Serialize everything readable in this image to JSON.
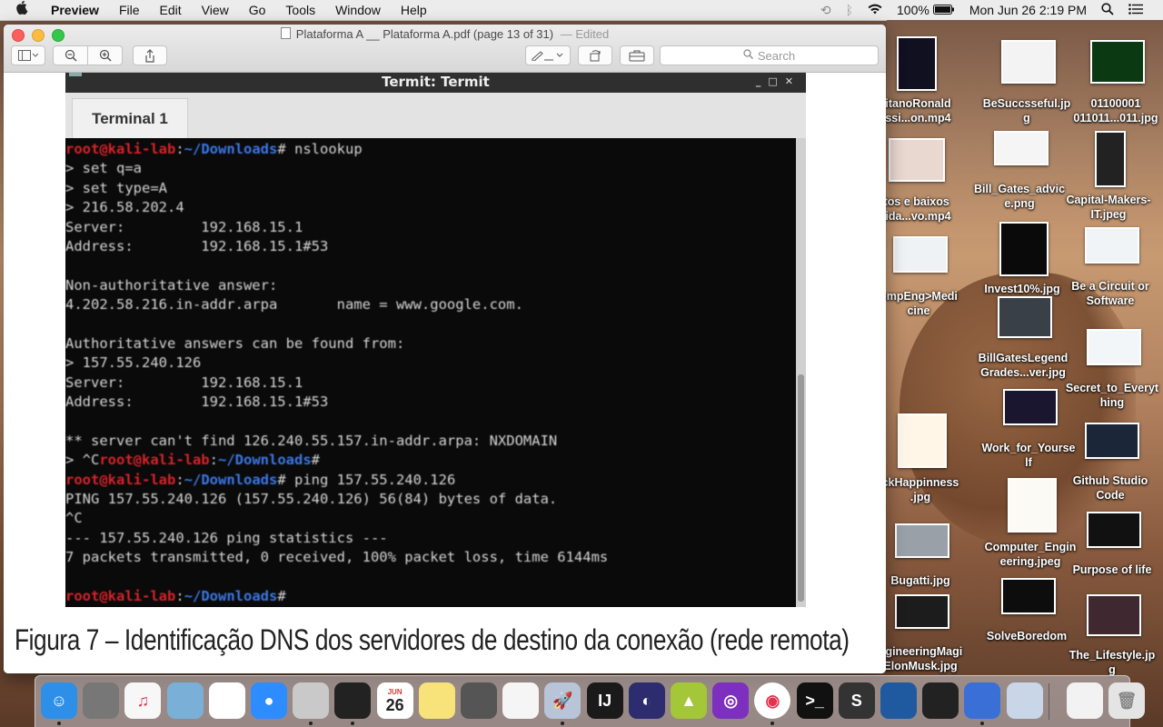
{
  "menubar": {
    "apple": "",
    "app_name": "Preview",
    "items": [
      "File",
      "Edit",
      "View",
      "Go",
      "Tools",
      "Window",
      "Help"
    ],
    "battery": "100%",
    "datetime": "Mon Jun 26  2:19 PM"
  },
  "window": {
    "title": "Plataforma A __ Plataforma A.pdf (page 13 of 31)",
    "edited": "— Edited",
    "search_placeholder": "Search"
  },
  "terminal": {
    "window_title": "Termit: Termit",
    "tab_label": "Terminal 1",
    "lines": [
      {
        "user": "root@kali-lab",
        "path": "~/Downloads",
        "cmd": "# nslookup"
      },
      {
        "text": "> set q=a"
      },
      {
        "text": "> set type=A"
      },
      {
        "text": "> 216.58.202.4"
      },
      {
        "text": "Server:         192.168.15.1"
      },
      {
        "text": "Address:        192.168.15.1#53"
      },
      {
        "text": ""
      },
      {
        "text": "Non-authoritative answer:"
      },
      {
        "text": "4.202.58.216.in-addr.arpa       name = www.google.com."
      },
      {
        "text": ""
      },
      {
        "text": "Authoritative answers can be found from:"
      },
      {
        "text": "> 157.55.240.126"
      },
      {
        "text": "Server:         192.168.15.1"
      },
      {
        "text": "Address:        192.168.15.1#53"
      },
      {
        "text": ""
      },
      {
        "text": "** server can't find 126.240.55.157.in-addr.arpa: NXDOMAIN"
      },
      {
        "prefix": "> ^C",
        "user": "root@kali-lab",
        "path": "~/Downloads",
        "cmd": "#"
      },
      {
        "user": "root@kali-lab",
        "path": "~/Downloads",
        "cmd": "# ping 157.55.240.126"
      },
      {
        "text": "PING 157.55.240.126 (157.55.240.126) 56(84) bytes of data."
      },
      {
        "text": "^C"
      },
      {
        "text": "--- 157.55.240.126 ping statistics ---"
      },
      {
        "text": "7 packets transmitted, 0 received, 100% packet loss, time 6144ms"
      },
      {
        "text": ""
      },
      {
        "user": "root@kali-lab",
        "path": "~/Downloads",
        "cmd": "#"
      }
    ]
  },
  "caption": "Figura 7 – Identificação DNS dos servidores de destino da conexão (rede remota)",
  "desktop_icons": [
    {
      "label": "sitanoRonald\nassi...on.mp4"
    },
    {
      "label": "BeSuccsseful.jp\ng"
    },
    {
      "label": "01100001\n011011...011.jpg"
    },
    {
      "label": "ltos e baixos\nvida...vo.mp4"
    },
    {
      "label": "Bill_Gates_advic\ne.png"
    },
    {
      "label": "Capital-Makers-\nIT.jpeg"
    },
    {
      "label": "ompEng>Medi\ncine"
    },
    {
      "label": "Invest10%.jpg"
    },
    {
      "label": "Be a Circuit or\nSoftware"
    },
    {
      "label": "BillGatesLegend\nGrades...ver.jpg"
    },
    {
      "label": "Secret_to_Everyt\nhing"
    },
    {
      "label": "Work_for_Yourse\nlf"
    },
    {
      "label": "ckHappinness\n.jpg"
    },
    {
      "label": "Github Studio\nCode"
    },
    {
      "label": "Computer_Engin\neering.jpeg"
    },
    {
      "label": "Purpose of life"
    },
    {
      "label": "Bugatti.jpg"
    },
    {
      "label": "SolveBoredom"
    },
    {
      "label": "ngineeringMagi\nElonMusk.jpg"
    },
    {
      "label": "The_Lifestyle.jp\ng"
    }
  ],
  "dock": {
    "calendar_month": "JUN",
    "calendar_day": "26",
    "apps": [
      "Finder",
      "System Preferences",
      "iTunes",
      "Preview",
      "Photos",
      "Zoom",
      "Xcode",
      "Activity Monitor",
      "Calendar",
      "Notes",
      "Calculator",
      "Reminders",
      "Launchpad",
      "IntelliJ IDEA",
      "Eclipse",
      "Android Studio",
      "Podcasts",
      "Chrome",
      "Terminal",
      "Sublime Text",
      "VirtualBox",
      "Quicktime",
      "Network",
      "Preview Docs",
      "Documents",
      "Trash"
    ]
  }
}
